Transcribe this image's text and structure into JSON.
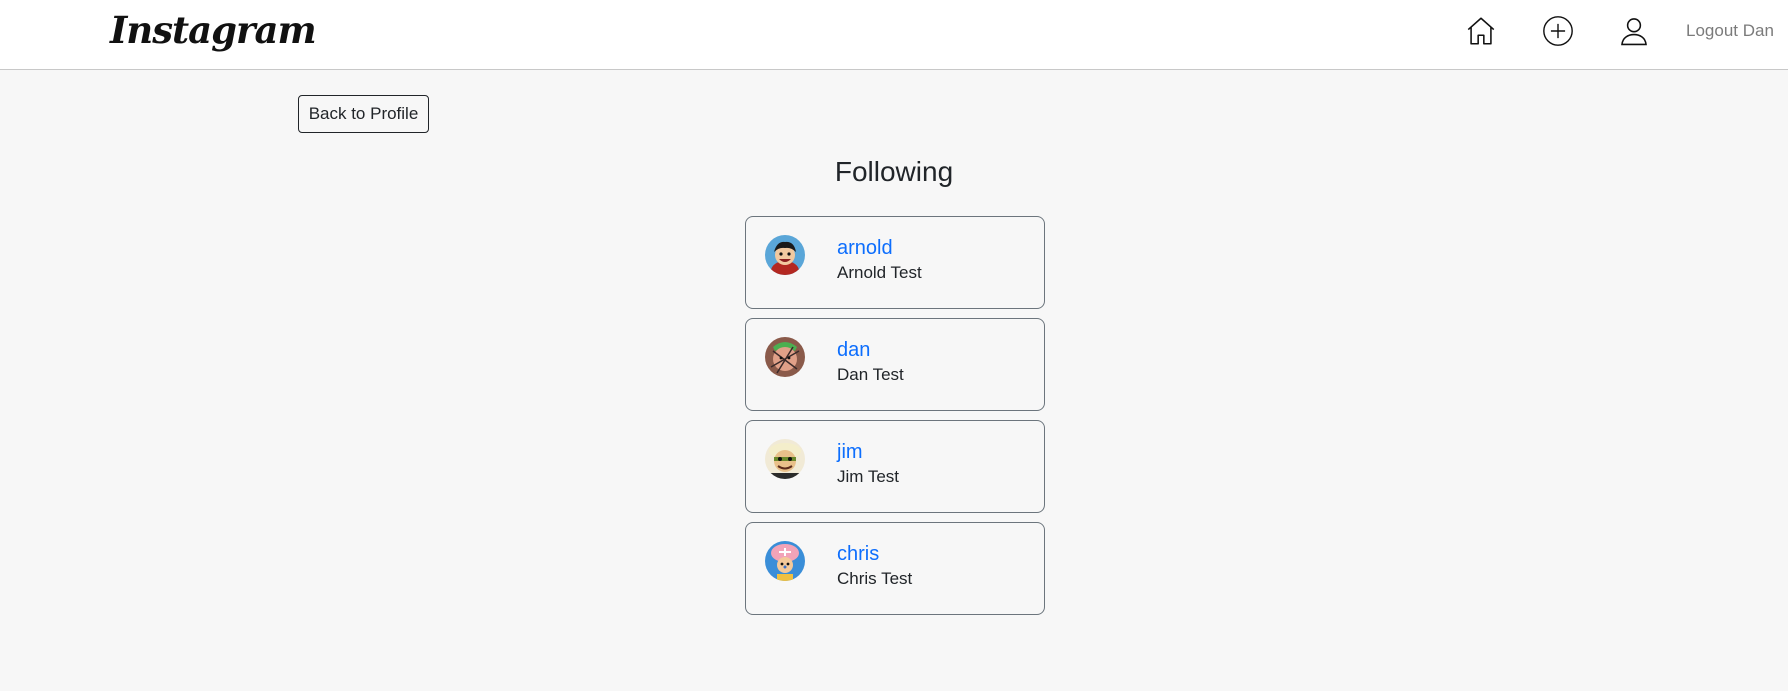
{
  "navbar": {
    "brand": "Instagram",
    "icons": [
      "home-icon",
      "plus-circle-icon",
      "person-icon"
    ],
    "logout_label": "Logout Dan"
  },
  "back_button_label": "Back to Profile",
  "page_title": "Following",
  "accent_color": "#0d6efd",
  "following": [
    {
      "username": "arnold",
      "full_name": "Arnold Test"
    },
    {
      "username": "dan",
      "full_name": "Dan Test"
    },
    {
      "username": "jim",
      "full_name": "Jim Test"
    },
    {
      "username": "chris",
      "full_name": "Chris Test"
    }
  ]
}
